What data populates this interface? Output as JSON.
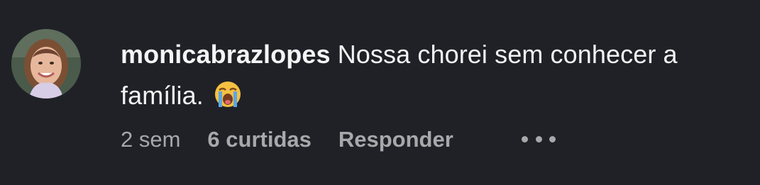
{
  "comment": {
    "username": "monicabrazlopes",
    "text": "Nossa chorei sem conhecer a família.",
    "emoji": "loudly-crying-face-icon",
    "time": "2 sem",
    "likes": "6 curtidas",
    "reply_label": "Responder",
    "more_icon": "more-options-icon"
  },
  "colors": {
    "background": "#202127",
    "text": "#f3f3f3",
    "meta": "#a8a8ab"
  }
}
